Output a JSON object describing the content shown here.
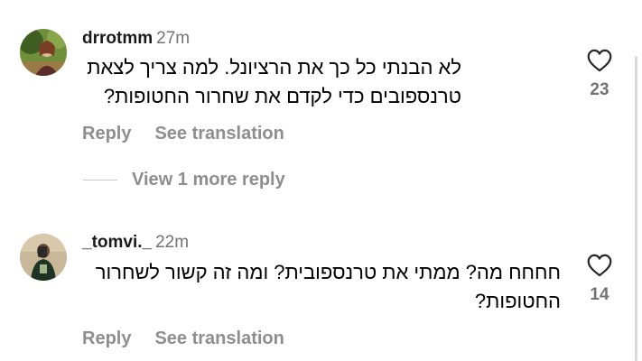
{
  "comments": [
    {
      "username": "drrotmm",
      "time": "27m",
      "text_lines": [
        "לא הבנתי כל כך את הרציונל. למה צריך לצאת",
        "טרנספובים כדי לקדם את שחרור החטופות?"
      ],
      "likes": "23",
      "reply_label": "Reply",
      "translate_label": "See translation"
    },
    {
      "username": "_tomvi._",
      "time": "22m",
      "text_lines": [
        "חחחח מה? ממתי את טרנספובית? ומה זה קשור לשחרור",
        "החטופות?"
      ],
      "likes": "14",
      "reply_label": "Reply",
      "translate_label": "See translation"
    }
  ],
  "view_more_replies": "View 1 more reply",
  "icons": {
    "like": "heart-outline-icon",
    "avatar_1": "user-avatar-photo",
    "avatar_2": "user-avatar-photo"
  },
  "colors": {
    "text_primary": "#000000",
    "text_secondary": "#737373",
    "action_gray": "#8e8e8e",
    "heart_stroke": "#262626"
  }
}
